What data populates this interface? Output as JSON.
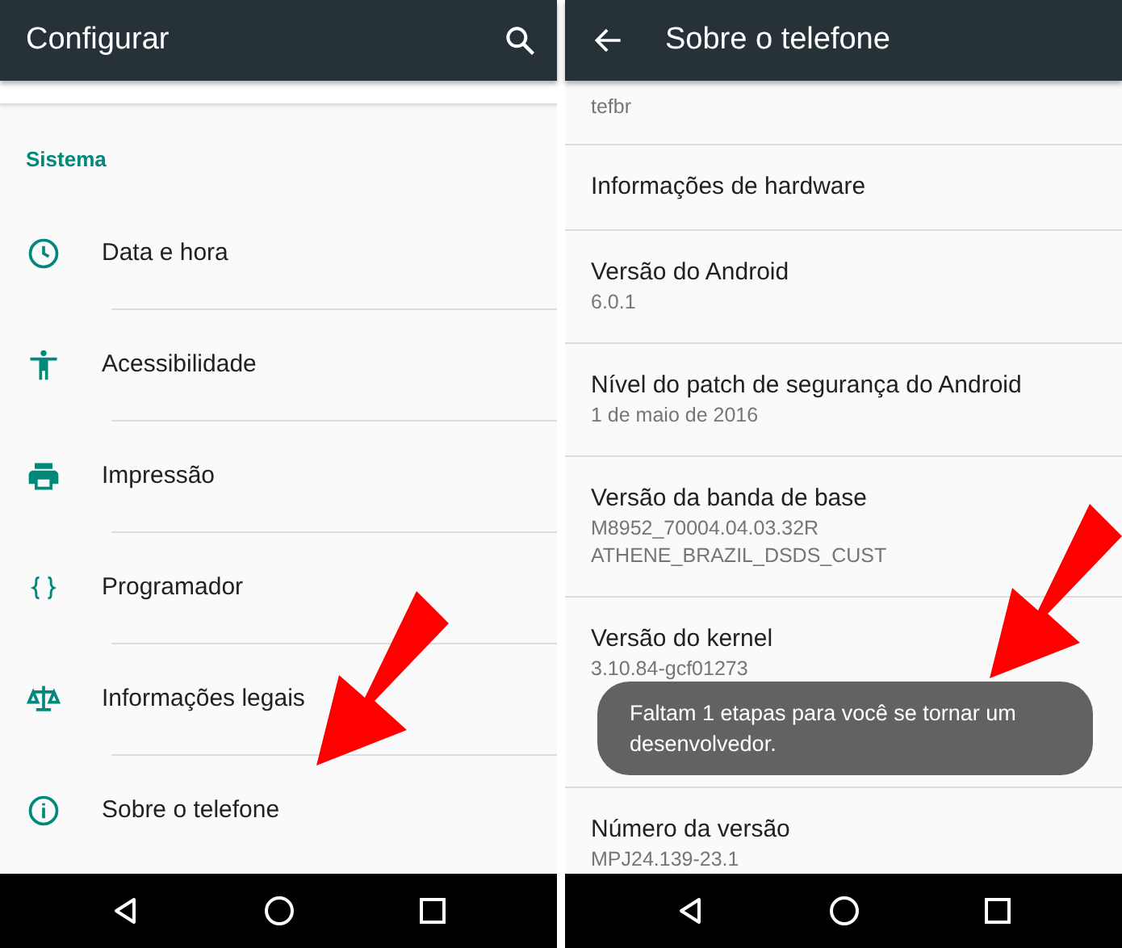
{
  "left": {
    "app_bar": {
      "title": "Configurar"
    },
    "section": "Sistema",
    "items": [
      {
        "label": "Data e hora"
      },
      {
        "label": "Acessibilidade"
      },
      {
        "label": "Impressão"
      },
      {
        "label": "Programador"
      },
      {
        "label": "Informações legais"
      },
      {
        "label": "Sobre o telefone"
      }
    ]
  },
  "right": {
    "app_bar": {
      "title": "Sobre o telefone"
    },
    "items": [
      {
        "summary": [
          "tefbr"
        ]
      },
      {
        "title": "Informações de hardware"
      },
      {
        "title": "Versão do Android",
        "summary": [
          "6.0.1"
        ]
      },
      {
        "title": "Nível do patch de segurança do Android",
        "summary": [
          "1 de maio de 2016"
        ]
      },
      {
        "title": "Versão da banda de base",
        "summary": [
          "M8952_70004.04.03.32R",
          "ATHENE_BRAZIL_DSDS_CUST"
        ]
      },
      {
        "title": "Versão do kernel",
        "summary": [
          "3.10.84-gcf01273"
        ]
      },
      {
        "title": "Número da versão",
        "summary": [
          "MPJ24.139-23.1"
        ]
      }
    ],
    "toast": "Faltam 1 etapas para você se tornar um desenvolvedor."
  }
}
